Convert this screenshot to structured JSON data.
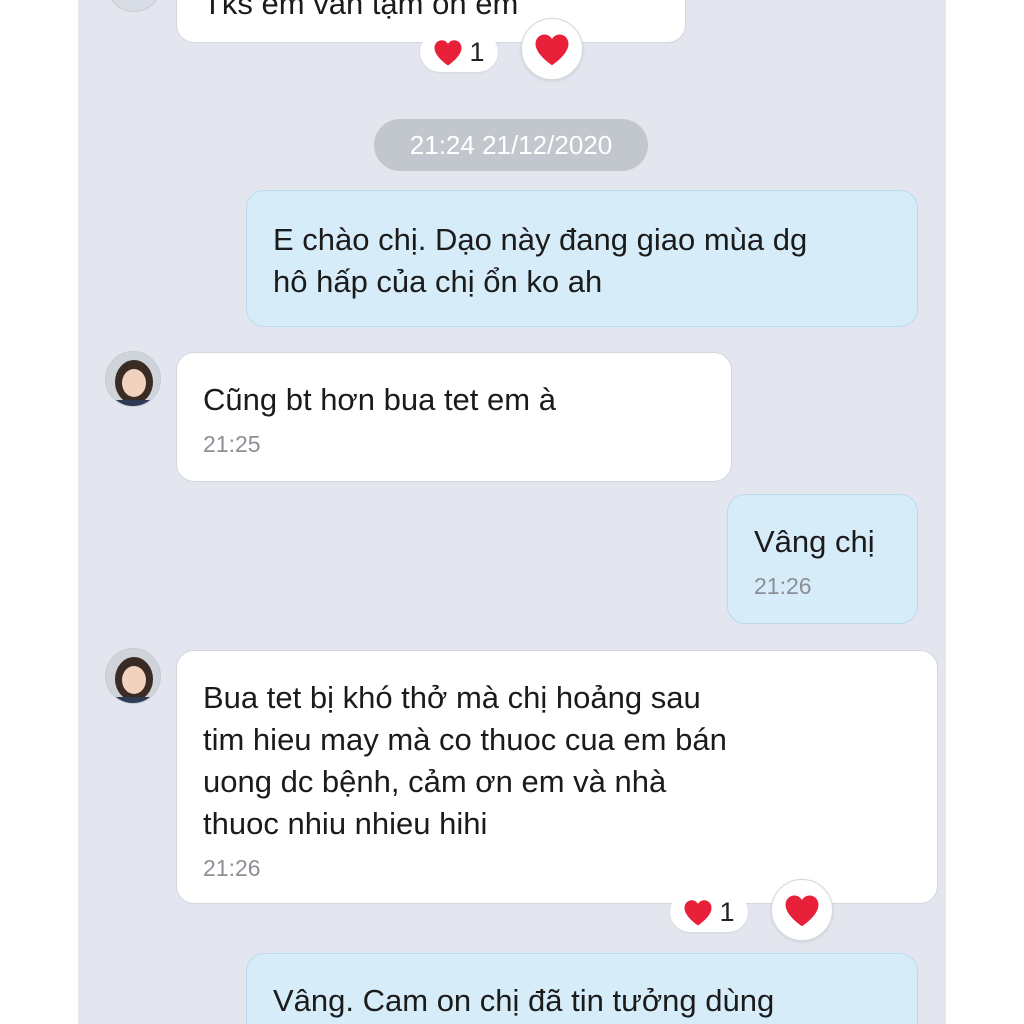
{
  "conversation": {
    "top_partial_message": {
      "text": "Tks em vẫn tạm ổn em",
      "reaction": {
        "icon": "heart-icon",
        "count": "1"
      }
    },
    "date_separator": "21:24 21/12/2020",
    "messages": [
      {
        "direction": "outgoing",
        "text": "E chào chị. Dạo này đang giao mùa  dg\nhô hấp của chị ổn ko ah",
        "time": ""
      },
      {
        "direction": "incoming",
        "text": "Cũng bt hơn bua tet em à",
        "time": "21:25"
      },
      {
        "direction": "outgoing",
        "text": "Vâng chị",
        "time": "21:26"
      },
      {
        "direction": "incoming",
        "text": "Bua tet bị khó thở mà chị hoảng sau\ntim hieu may mà co thuoc cua em bán\nuong dc bệnh, cảm ơn em và nhà\nthuoc nhiu nhieu hihi",
        "time": "21:26",
        "reaction": {
          "icon": "heart-icon",
          "count": "1"
        }
      },
      {
        "direction": "outgoing",
        "text": "Vâng. Cam on chị đã tin tưởng dùng",
        "time": ""
      }
    ]
  },
  "colors": {
    "chat_background": "#e3e6ee",
    "incoming_bubble": "#ffffff",
    "outgoing_bubble": "#d6ecf9",
    "date_pill": "#c2c6cd",
    "heart": "#e8203a"
  }
}
